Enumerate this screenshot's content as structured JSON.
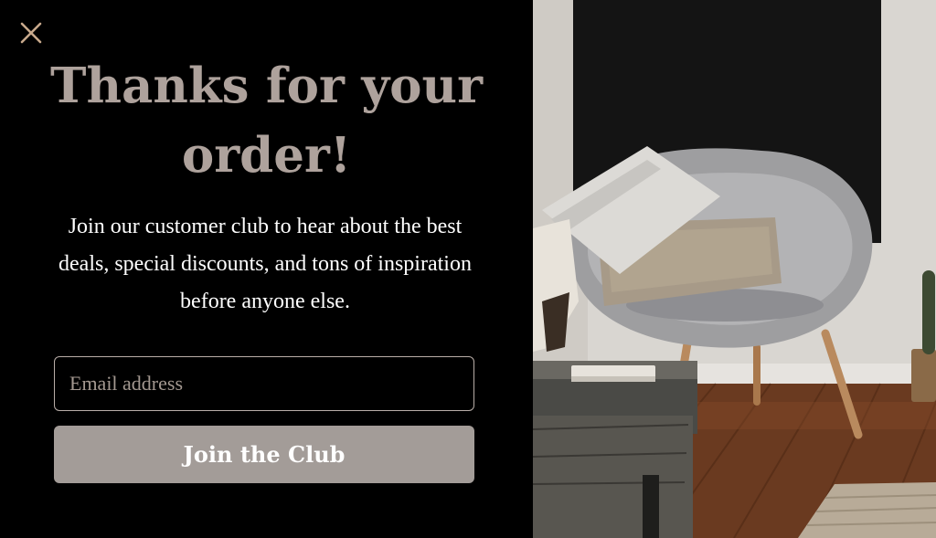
{
  "popup": {
    "close_icon": "close-icon",
    "headline": "Thanks for your order!",
    "description": "Join our customer club to hear about the best deals, special discounts, and tons of inspiration before anyone else.",
    "email_placeholder": "Email address",
    "email_value": "",
    "join_button_label": "Join the Club"
  },
  "colors": {
    "background": "#000000",
    "headline": "#aea29c",
    "close_icon": "#c8a98c",
    "button_bg": "#a39c98",
    "input_border": "#b9aea8"
  }
}
